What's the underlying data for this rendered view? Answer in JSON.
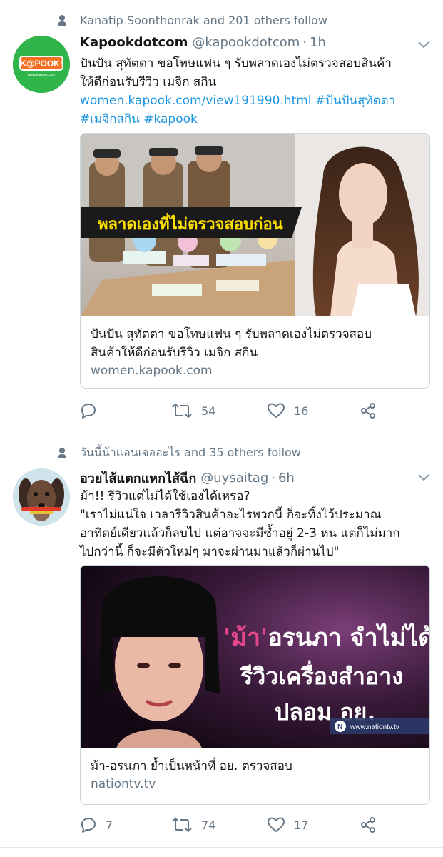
{
  "tweets": [
    {
      "social_context": "Kanatip Soonthonrak and 201 others follow",
      "avatar_text": "K@POOK!",
      "avatar_subtext": "www.kapook.com",
      "name": "Kapookdotcom",
      "handle": "@kapookdotcom",
      "time": "1h",
      "text_lines": [
        "ปันปัน สุทัตตา ขอโทษแฟน ๆ รับพลาดเองไม่ตรวจสอบสินค้า",
        "ให้ดีก่อนรับรีวิว เมจิก สกิน"
      ],
      "link": "women.kapook.com/view191990.html",
      "hashtags_line1": "#ปันปันสุทัตตา",
      "hashtags_line2": "#เมจิกสกิน #kapook",
      "card": {
        "image_caption": "พลาดเองที่ไม่ตรวจสอบก่อน",
        "title_lines": [
          "ปันปัน สุทัตตา ขอโทษแฟน ๆ รับพลาดเองไม่ตรวจสอบ",
          "สินค้าให้ดีก่อนรับรีวิว เมจิก สกิน"
        ],
        "domain": "women.kapook.com"
      },
      "actions": {
        "replies": "",
        "retweets": "54",
        "likes": "16"
      }
    },
    {
      "social_context": "วันนี้น้าแอนเจออะไร and 35 others follow",
      "name": "อวยไส้แตกแหกไส้ฉีก",
      "handle": "@uysaitag",
      "time": "6h",
      "text_lines": [
        "ม้า!! รีวิวแต่ไม่ได้ใช้เองได้เหรอ?",
        "\"เราไม่แน่ใจ เวลารีวิวสินค้าอะไรพวกนี้ ก็จะทิ้งไว้ประมาณ",
        "อาทิตย์เดียวแล้วก็ลบไป แต่อาจจะมีซ้ำอยู่ 2-3 หน แต่ก็ไม่มาก",
        "ไปกว่านี้ ก็จะมีตัวใหม่ๆ มาจะผ่านมาแล้วก็ผ่านไป\""
      ],
      "card": {
        "image_line1_highlight": "'ม้า'",
        "image_line1_rest": "อรนภา จำไม่ได้",
        "image_line2": "รีวิวเครื่องสำอาง",
        "image_line3": "ปลอม อย.",
        "image_watermark": "www.nationtv.tv",
        "title_lines": [
          "ม้า-อรนภา ย้ำเป็นหน้าที่ อย. ตรวจสอบ"
        ],
        "domain": "nationtv.tv"
      },
      "actions": {
        "replies": "7",
        "retweets": "74",
        "likes": "17"
      }
    }
  ],
  "colors": {
    "link": "#1b95e0",
    "secondary_text": "#657786",
    "kapook_green": "#2fb54a",
    "kapook_orange": "#f36f21",
    "nation_pink": "#e8478c"
  },
  "icons": [
    "person-icon",
    "chevron-down-icon",
    "reply-icon",
    "retweet-icon",
    "like-icon",
    "share-icon"
  ]
}
